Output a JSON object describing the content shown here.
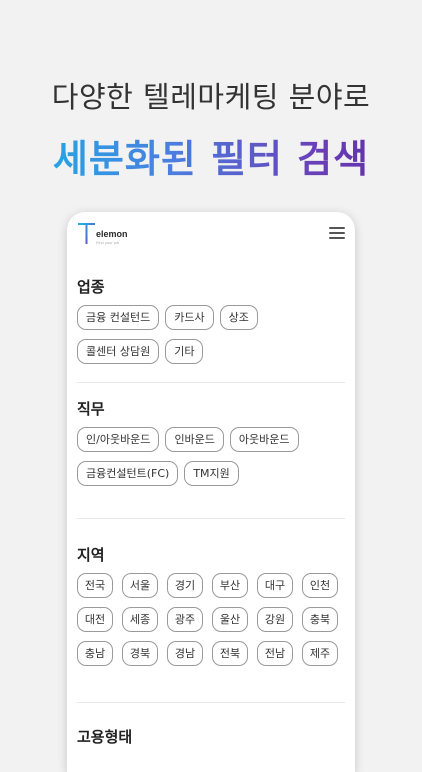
{
  "promo": {
    "headline": "다양한 텔레마케팅 분야로",
    "subhead": "세분화된 필터 검색"
  },
  "app": {
    "logo_text": "elemon",
    "logo_tagline": "Find your job"
  },
  "filters": {
    "industry": {
      "title": "업종",
      "options": [
        "금융 컨설턴드",
        "카드사",
        "상조",
        "콜센터 상담원",
        "기타"
      ]
    },
    "job": {
      "title": "직무",
      "options": [
        "인/아웃바운드",
        "인바운드",
        "아웃바운드",
        "금융컨설턴트(FC)",
        "TM지원"
      ]
    },
    "region": {
      "title": "지역",
      "options": [
        "전국",
        "서울",
        "경기",
        "부산",
        "대구",
        "인천",
        "대전",
        "세종",
        "광주",
        "울산",
        "강원",
        "충북",
        "충남",
        "경북",
        "경남",
        "전북",
        "전남",
        "제주"
      ]
    },
    "employment": {
      "title": "고용형태"
    }
  },
  "colors": {
    "gradient_start": "#16b3e6",
    "gradient_end": "#5a2aa0",
    "chip_border": "#9a9a9a"
  }
}
